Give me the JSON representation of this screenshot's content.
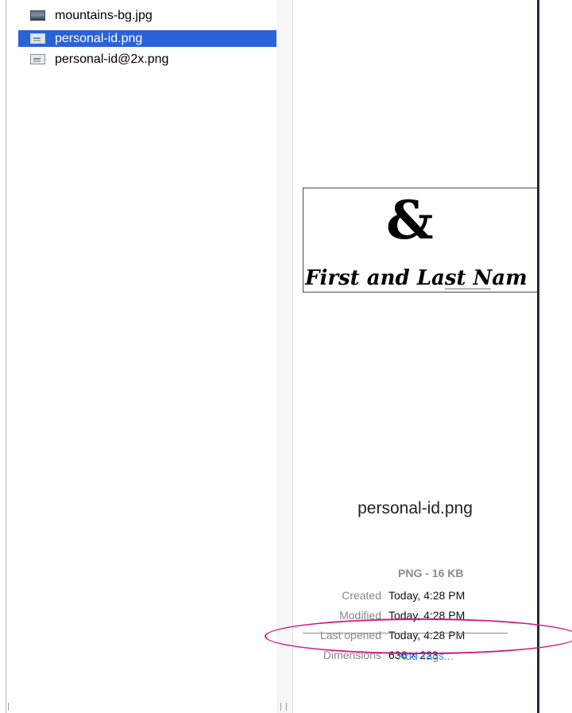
{
  "files": [
    {
      "name": "mountains-bg.jpg",
      "icon": "photo-thumbnail-icon",
      "selected": false
    },
    {
      "name": "personal-id.png",
      "icon": "png-thumbnail-icon",
      "selected": true
    },
    {
      "name": "personal-id@2x.png",
      "icon": "png-thumbnail-icon",
      "selected": false
    }
  ],
  "preview": {
    "image_text": {
      "ampersand": "&",
      "name": "First and Last Nam"
    },
    "filename": "personal-id.png",
    "kind_size": "PNG - 16 KB",
    "created": {
      "label": "Created",
      "value": "Today, 4:28 PM"
    },
    "modified": {
      "label": "Modified",
      "value": "Today, 4:28 PM"
    },
    "last_opened": {
      "label": "Last opened",
      "value": "Today, 4:28 PM"
    },
    "dimensions": {
      "label": "Dimensions",
      "value": "636 × 223"
    },
    "add_tags": "Add Tags..."
  },
  "colors": {
    "selection": "#2a62d8",
    "link": "#3d8bf6",
    "annotation": "#d21a7c"
  }
}
